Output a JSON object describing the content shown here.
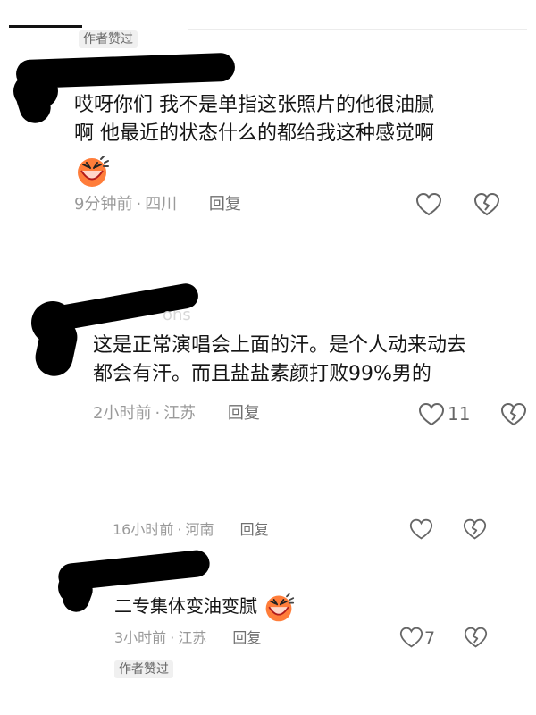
{
  "comments": [
    {
      "badge": "作者赞过",
      "content_lines": [
        "哎呀你们 我不是单指这张照片的他很油腻",
        "啊 他最近的状态什么的都给我这种感觉啊"
      ],
      "has_emoji": true,
      "time": "9分钟前",
      "location": "四川",
      "reply": "回复",
      "likes": ""
    },
    {
      "username_fragment": "ons",
      "content_lines": [
        "这是正常演唱会上面的汗。是个人动来动去",
        "都会有汗。而且盐盐素颜打败99%男的"
      ],
      "time": "2小时前",
      "location": "江苏",
      "reply": "回复",
      "likes": "11"
    },
    {
      "time": "16小时前",
      "location": "河南",
      "reply": "回复",
      "likes": ""
    },
    {
      "content": "二专集体变油变腻",
      "has_emoji": true,
      "time": "3小时前",
      "location": "江苏",
      "reply": "回复",
      "likes": "7",
      "badge": "作者赞过"
    }
  ],
  "icons": {
    "like": "heart-icon",
    "dislike": "broken-heart-icon"
  },
  "colors": {
    "text": "#151515",
    "meta": "#9a9a9a",
    "badge_bg": "#f0f0f0",
    "icon": "#666666",
    "redaction": "#000000",
    "emoji": "#ff7d3a"
  }
}
